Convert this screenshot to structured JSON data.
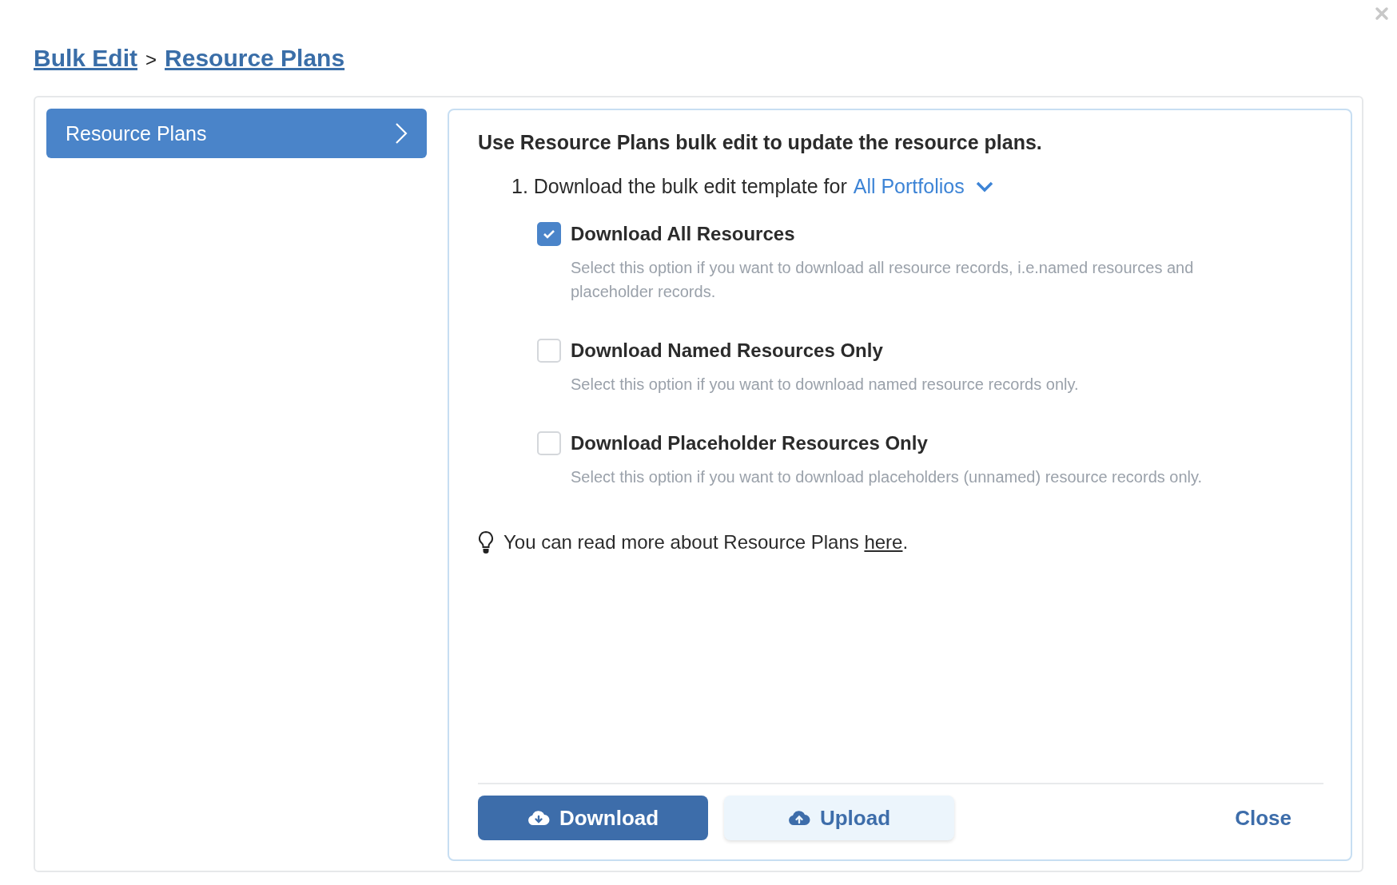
{
  "breadcrumb": [
    {
      "label": "Bulk Edit"
    },
    {
      "label": "Resource Plans"
    }
  ],
  "breadcrumb_separator": ">",
  "sidebar": {
    "items": [
      {
        "label": "Resource Plans",
        "selected": true
      }
    ]
  },
  "content": {
    "heading": "Use Resource Plans bulk edit to update the resource plans.",
    "step": {
      "number": "1.",
      "text": "Download the bulk edit template for",
      "dropdown_value": "All Portfolios"
    },
    "options": [
      {
        "label": "Download All Resources",
        "description": "Select this option if you want to download all resource records, i.e.named resources and placeholder records.",
        "checked": true
      },
      {
        "label": "Download Named Resources Only",
        "description": "Select this option if you want to download named resource records only.",
        "checked": false
      },
      {
        "label": "Download Placeholder Resources Only",
        "description": "Select this option if you want to download placeholders (unnamed) resource records only.",
        "checked": false
      }
    ],
    "tip": {
      "text": "You can read more about Resource Plans",
      "link": "here",
      "end": "."
    }
  },
  "buttons": [
    {
      "label": "Download",
      "kind": "primary"
    },
    {
      "label": "Upload",
      "kind": "secondary"
    },
    {
      "label": "Close",
      "kind": "link"
    }
  ]
}
